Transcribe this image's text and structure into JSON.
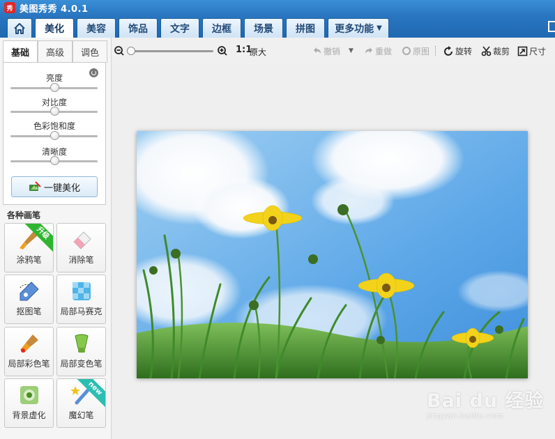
{
  "app": {
    "title": "美图秀秀 4.0.1",
    "logo_text": "秀"
  },
  "tabs": [
    {
      "label": "美化",
      "active": true
    },
    {
      "label": "美容"
    },
    {
      "label": "饰品"
    },
    {
      "label": "文字"
    },
    {
      "label": "边框"
    },
    {
      "label": "场景"
    },
    {
      "label": "拼图"
    },
    {
      "label": "更多功能"
    }
  ],
  "left_panel": {
    "subtabs": [
      {
        "label": "基础",
        "active": true
      },
      {
        "label": "高级"
      },
      {
        "label": "调色"
      }
    ],
    "sliders": [
      {
        "label": "亮度",
        "value_pct": 50
      },
      {
        "label": "对比度",
        "value_pct": 50
      },
      {
        "label": "色彩饱和度",
        "value_pct": 50
      },
      {
        "label": "清晰度",
        "value_pct": 50
      }
    ],
    "one_click_label": "一键美化",
    "brushes_heading": "各种画笔",
    "brushes": [
      {
        "label": "涂鸦笔",
        "icon": "brush-icon",
        "badge": "升级"
      },
      {
        "label": "消除笔",
        "icon": "eraser-icon"
      },
      {
        "label": "抠图笔",
        "icon": "pen-cutout-icon"
      },
      {
        "label": "局部马赛克",
        "icon": "mosaic-icon"
      },
      {
        "label": "局部彩色笔",
        "icon": "color-brush-icon"
      },
      {
        "label": "局部变色笔",
        "icon": "color-change-icon"
      },
      {
        "label": "背景虚化",
        "icon": "blur-icon"
      },
      {
        "label": "魔幻笔",
        "icon": "magic-wand-icon",
        "badge": "new"
      }
    ]
  },
  "toolbar": {
    "zoom_level_pct": 0,
    "ratio_label": "1:1",
    "original_size_label": "原大",
    "undo_label": "撤销",
    "redo_label": "重做",
    "original_label": "原图",
    "rotate_label": "旋转",
    "crop_label": "裁剪",
    "size_label": "尺寸"
  },
  "watermark": {
    "main": "Bai du 经验",
    "sub": "jingyan.baidu.com"
  },
  "colors": {
    "titlebar": "#2a76c0",
    "sky": "#6fb3ee",
    "grass": "#3f8a2a",
    "flower": "#f2d21a"
  }
}
